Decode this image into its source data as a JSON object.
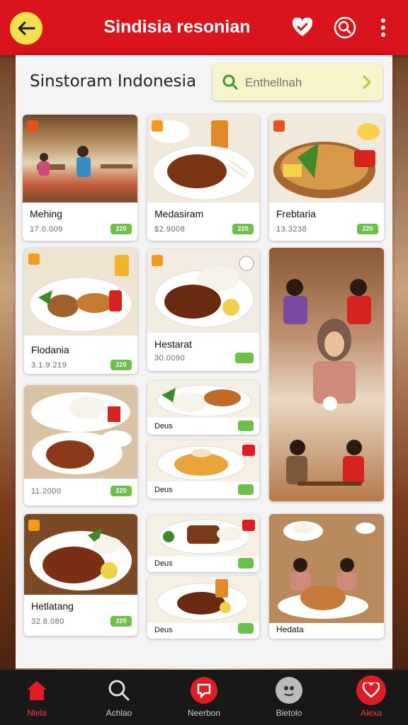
{
  "app": {
    "title": "Sindisia resonian"
  },
  "page": {
    "title": "Sinstoram Indonesia"
  },
  "search": {
    "placeholder": "Enthellnah"
  },
  "colors": {
    "primary": "#d9141c",
    "accent_yellow": "#f2e14b",
    "badge_green": "#6cc04a",
    "badge_orange": "#f59a1d"
  },
  "cards": [
    {
      "name": "Mehing",
      "price": "17.0.009",
      "badge": "",
      "pill": "220",
      "image": "restaurant-interior"
    },
    {
      "name": "Medasiram",
      "price": "$2.9008",
      "badge": "",
      "pill": "220",
      "image": "fried-chicken-plate"
    },
    {
      "name": "Frebtaria",
      "price": "13.3238",
      "badge": "",
      "pill": "220",
      "image": "grilled-fish-platter"
    },
    {
      "name": "Flodania",
      "price": "3.1.9.219",
      "badge": "",
      "pill": "220",
      "image": "satay-plate"
    },
    {
      "name": "Hestarat",
      "price": "30.0090",
      "badge": "",
      "pill": "",
      "image": "rendang-plate"
    },
    {
      "name": "",
      "price": "11.2000",
      "badge": "",
      "pill": "220",
      "image": "nasi-campur"
    },
    {
      "name": "Deus",
      "price": "",
      "badge": "",
      "pill": "",
      "image": "rice-plate"
    },
    {
      "name": "Deus",
      "price": "",
      "badge": "",
      "pill": "",
      "image": "noodle-plate"
    },
    {
      "name": "Hetlatang",
      "price": "32.8.080",
      "badge": "",
      "pill": "220",
      "image": "chicken-curry"
    },
    {
      "name": "Deus",
      "price": "",
      "badge": "",
      "pill": "",
      "image": "satay-rice"
    },
    {
      "name": "Deus",
      "price": "",
      "badge": "",
      "pill": "",
      "image": "ayam-bakar"
    },
    {
      "name": "Hedata",
      "price": "",
      "badge": "",
      "pill": "",
      "image": "restaurant-diners"
    }
  ],
  "nav": [
    {
      "label": "Nlela",
      "icon": "home-icon"
    },
    {
      "label": "Achlao",
      "icon": "search-icon"
    },
    {
      "label": "Neerbon",
      "icon": "chat-icon"
    },
    {
      "label": "Bietolo",
      "icon": "profile-icon"
    },
    {
      "label": "Alexa",
      "icon": "heart-icon"
    }
  ]
}
